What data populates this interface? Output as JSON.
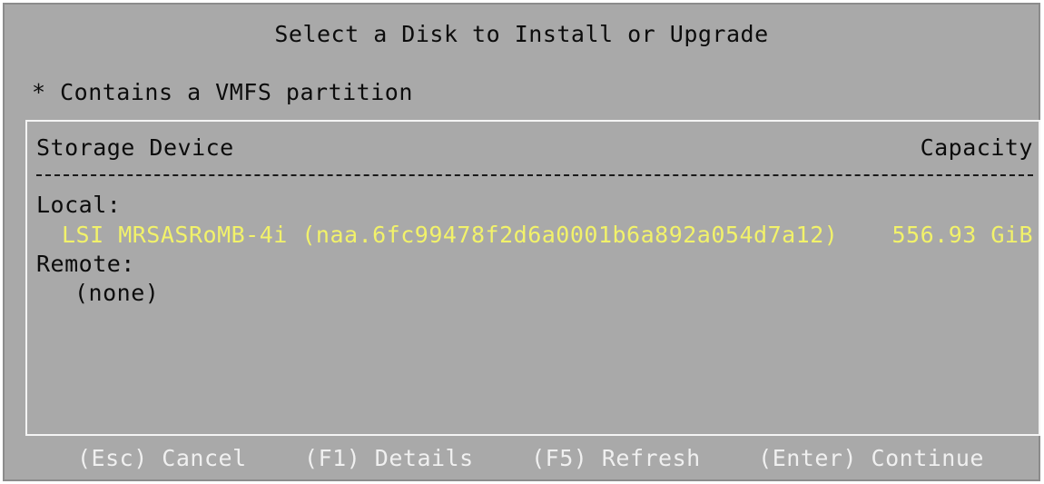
{
  "screen": {
    "title": "Select a Disk to Install or Upgrade",
    "legend": "* Contains a VMFS partition"
  },
  "table": {
    "header_device": "Storage Device",
    "header_capacity": "Capacity",
    "groups": [
      {
        "label": "Local:",
        "devices": [
          {
            "name": "LSI MRSASRoMB-4i (naa.6fc99478f2d6a0001b6a892a054d7a12)",
            "capacity": "556.93 GiB"
          }
        ]
      },
      {
        "label": "Remote:",
        "empty_text": "(none)"
      }
    ]
  },
  "footer": {
    "cancel": "(Esc) Cancel",
    "details": "(F1) Details",
    "refresh": "(F5) Refresh",
    "continue": "(Enter) Continue"
  },
  "colors": {
    "background": "#a9a9a9",
    "selected_text": "#f2f26a",
    "footer_text": "#f0f0f0",
    "box_border": "#f4f4f4"
  }
}
